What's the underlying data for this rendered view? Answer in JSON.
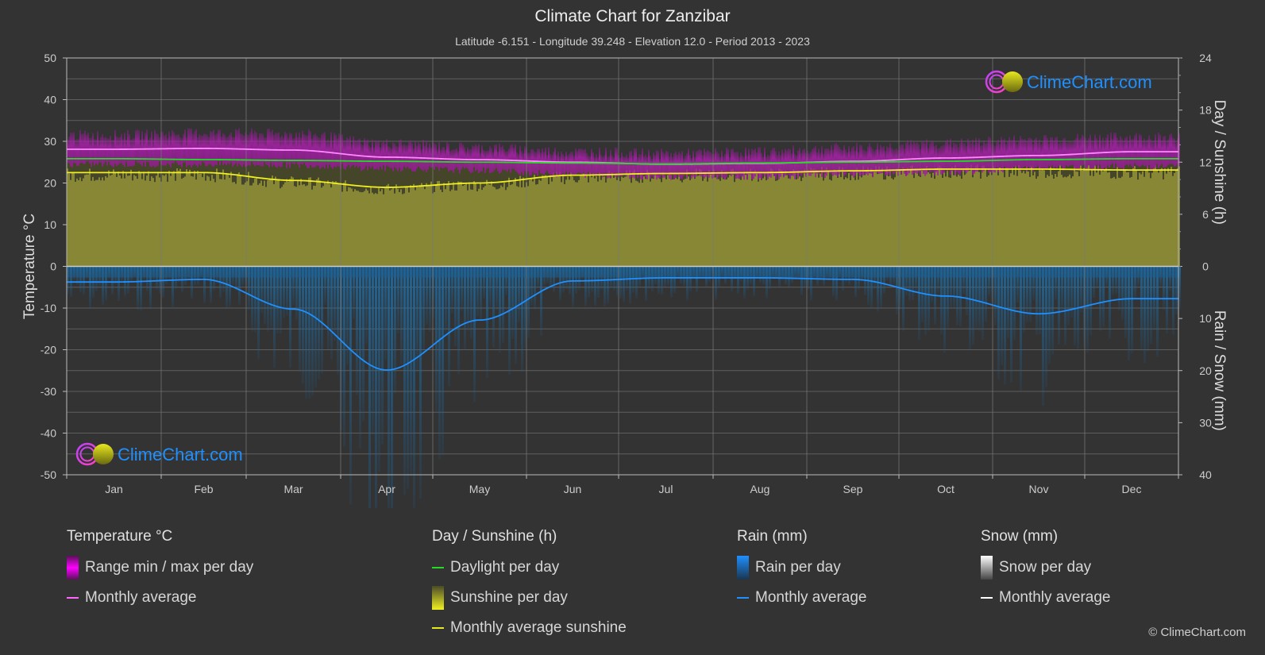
{
  "header": {
    "title": "Climate Chart for Zanzibar",
    "subtitle": "Latitude -6.151 - Longitude 39.248 - Elevation 12.0 - Period 2013 - 2023"
  },
  "logo_text": "ClimeChart.com",
  "copyright": "© ClimeChart.com",
  "colors": {
    "background": "#333333",
    "temp_range": "#c020c0",
    "temp_avg": "#ff80ff",
    "daylight": "#22dd22",
    "sunshine_fill": "#8b8b36",
    "sunshine_avg": "#f0f020",
    "rain_fill": "#1e5f8f",
    "rain_avg": "#1e90ff",
    "snow_avg": "#ffffff",
    "logo_blue": "#1e90ff"
  },
  "chart_data": {
    "type": "area",
    "title": "Climate Chart for Zanzibar",
    "categories": [
      "Jan",
      "Feb",
      "Mar",
      "Apr",
      "May",
      "Jun",
      "Jul",
      "Aug",
      "Sep",
      "Oct",
      "Nov",
      "Dec"
    ],
    "axes": {
      "left": {
        "label": "Temperature °C",
        "min": -50,
        "max": 50,
        "ticks": [
          "50",
          "40",
          "30",
          "20",
          "10",
          "0",
          "-10",
          "-20",
          "-30",
          "-40",
          "-50"
        ]
      },
      "right_top": {
        "label": "Day / Sunshine (h)",
        "min": 0,
        "max": 24,
        "ticks": [
          "24",
          "18",
          "12",
          "6",
          "0"
        ]
      },
      "right_bottom": {
        "label": "Rain / Snow (mm)",
        "min": 0,
        "max": 40,
        "ticks": [
          "10",
          "20",
          "30",
          "40"
        ]
      }
    },
    "grid": true,
    "series": [
      {
        "name": "Temperature monthly average",
        "unit": "°C",
        "axis": "left",
        "values": [
          28.1,
          28.3,
          27.9,
          26.2,
          25.6,
          25.0,
          24.5,
          24.7,
          25.2,
          26.0,
          26.6,
          27.5
        ]
      },
      {
        "name": "Temperature range max per day (approx.)",
        "unit": "°C",
        "axis": "left",
        "values": [
          31.5,
          32.0,
          31.8,
          29.5,
          28.5,
          27.5,
          27.0,
          27.5,
          28.5,
          29.5,
          30.5,
          31.0
        ]
      },
      {
        "name": "Temperature range min per day (approx.)",
        "unit": "°C",
        "axis": "left",
        "values": [
          24.5,
          24.5,
          24.3,
          23.5,
          23.0,
          22.0,
          21.5,
          21.5,
          22.0,
          22.5,
          23.5,
          24.0
        ]
      },
      {
        "name": "Daylight per day",
        "unit": "h",
        "axis": "right_top",
        "values": [
          12.4,
          12.3,
          12.2,
          12.1,
          12.0,
          11.9,
          11.8,
          11.9,
          12.0,
          12.1,
          12.3,
          12.4
        ]
      },
      {
        "name": "Monthly average sunshine",
        "unit": "h",
        "axis": "right_top",
        "values": [
          10.8,
          10.8,
          9.9,
          9.1,
          9.6,
          10.5,
          10.7,
          10.8,
          11.0,
          11.2,
          11.2,
          11.1
        ]
      },
      {
        "name": "Rain monthly average",
        "unit": "mm",
        "axis": "right_bottom",
        "values": [
          3.0,
          2.5,
          8.2,
          19.9,
          10.3,
          2.8,
          2.2,
          2.2,
          2.5,
          5.7,
          9.1,
          6.2
        ]
      },
      {
        "name": "Snow monthly average",
        "unit": "mm",
        "axis": "right_bottom",
        "values": [
          0,
          0,
          0,
          0,
          0,
          0,
          0,
          0,
          0,
          0,
          0,
          0
        ]
      }
    ]
  },
  "legend": {
    "temperature": {
      "title": "Temperature °C",
      "items": [
        "Range min / max per day",
        "Monthly average"
      ]
    },
    "sunshine": {
      "title": "Day / Sunshine (h)",
      "items": [
        "Daylight per day",
        "Sunshine per day",
        "Monthly average sunshine"
      ]
    },
    "rain": {
      "title": "Rain (mm)",
      "items": [
        "Rain per day",
        "Monthly average"
      ]
    },
    "snow": {
      "title": "Snow (mm)",
      "items": [
        "Snow per day",
        "Monthly average"
      ]
    }
  }
}
